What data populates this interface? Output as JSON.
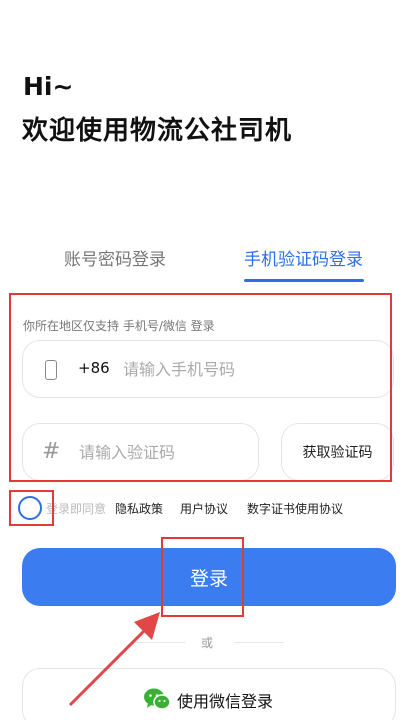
{
  "header": {
    "greeting": "Hi~",
    "welcome": "欢迎使用物流公社司机"
  },
  "tabs": [
    {
      "label": "账号密码登录",
      "active": false
    },
    {
      "label": "手机验证码登录",
      "active": true
    }
  ],
  "form": {
    "region_hint": "你所在地区仅支持 手机号/微信 登录",
    "country_code": "+86",
    "phone_placeholder": "请输入手机号码",
    "code_placeholder": "请输入验证码",
    "get_code_label": "获取验证码"
  },
  "agreement": {
    "prefix": "登录即同意",
    "links": [
      "隐私政策",
      "用户协议",
      "数字证书使用协议"
    ]
  },
  "login_button_label": "登录",
  "or_text": "或",
  "wechat_login_label": "使用微信登录",
  "colors": {
    "accent": "#2d6fe8",
    "login_button": "#3b7cf0",
    "annotation": "#e03a3a",
    "wechat": "#3cb034"
  }
}
